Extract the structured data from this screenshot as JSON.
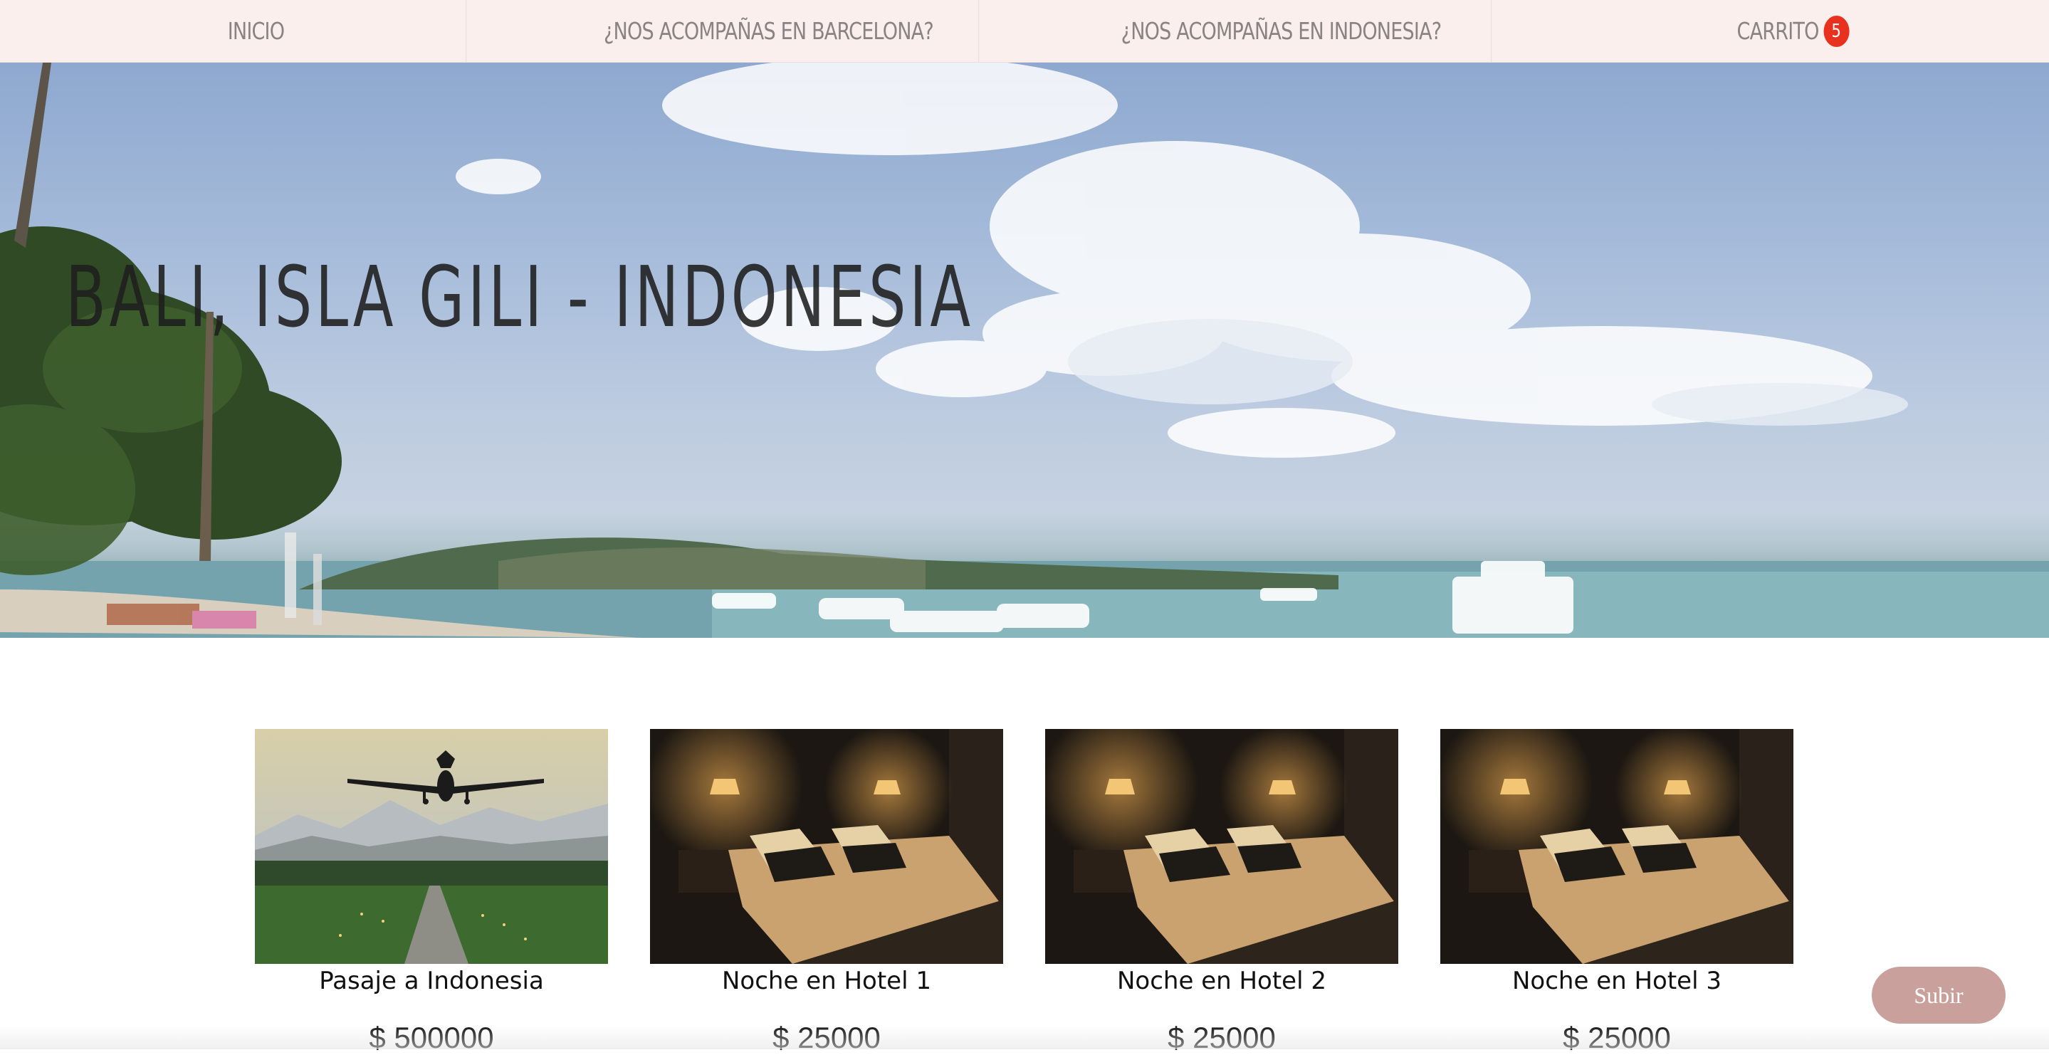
{
  "nav": {
    "items": [
      {
        "label": "INICIO"
      },
      {
        "label": "¿NOS ACOMPAÑAS EN BARCELONA?"
      },
      {
        "label": "¿NOS ACOMPAÑAS EN INDONESIA?"
      },
      {
        "label": "CARRITO"
      }
    ],
    "cart_count": "5"
  },
  "hero": {
    "title": "BALI, ISLA GILI - INDONESIA"
  },
  "products": [
    {
      "name": "Pasaje a Indonesia",
      "price": "$ 500000",
      "image": "airplane-landing-photo"
    },
    {
      "name": "Noche en Hotel 1",
      "price": "$ 25000",
      "image": "hotel-room-photo"
    },
    {
      "name": "Noche en Hotel 2",
      "price": "$ 25000",
      "image": "hotel-room-photo"
    },
    {
      "name": "Noche en Hotel 3",
      "price": "$ 25000",
      "image": "hotel-room-photo"
    }
  ],
  "scroll_top_button": {
    "label": "Subir"
  },
  "colors": {
    "nav_bg": "#fbefed",
    "badge": "#e8321f",
    "subir_button": "#c9a09b"
  }
}
